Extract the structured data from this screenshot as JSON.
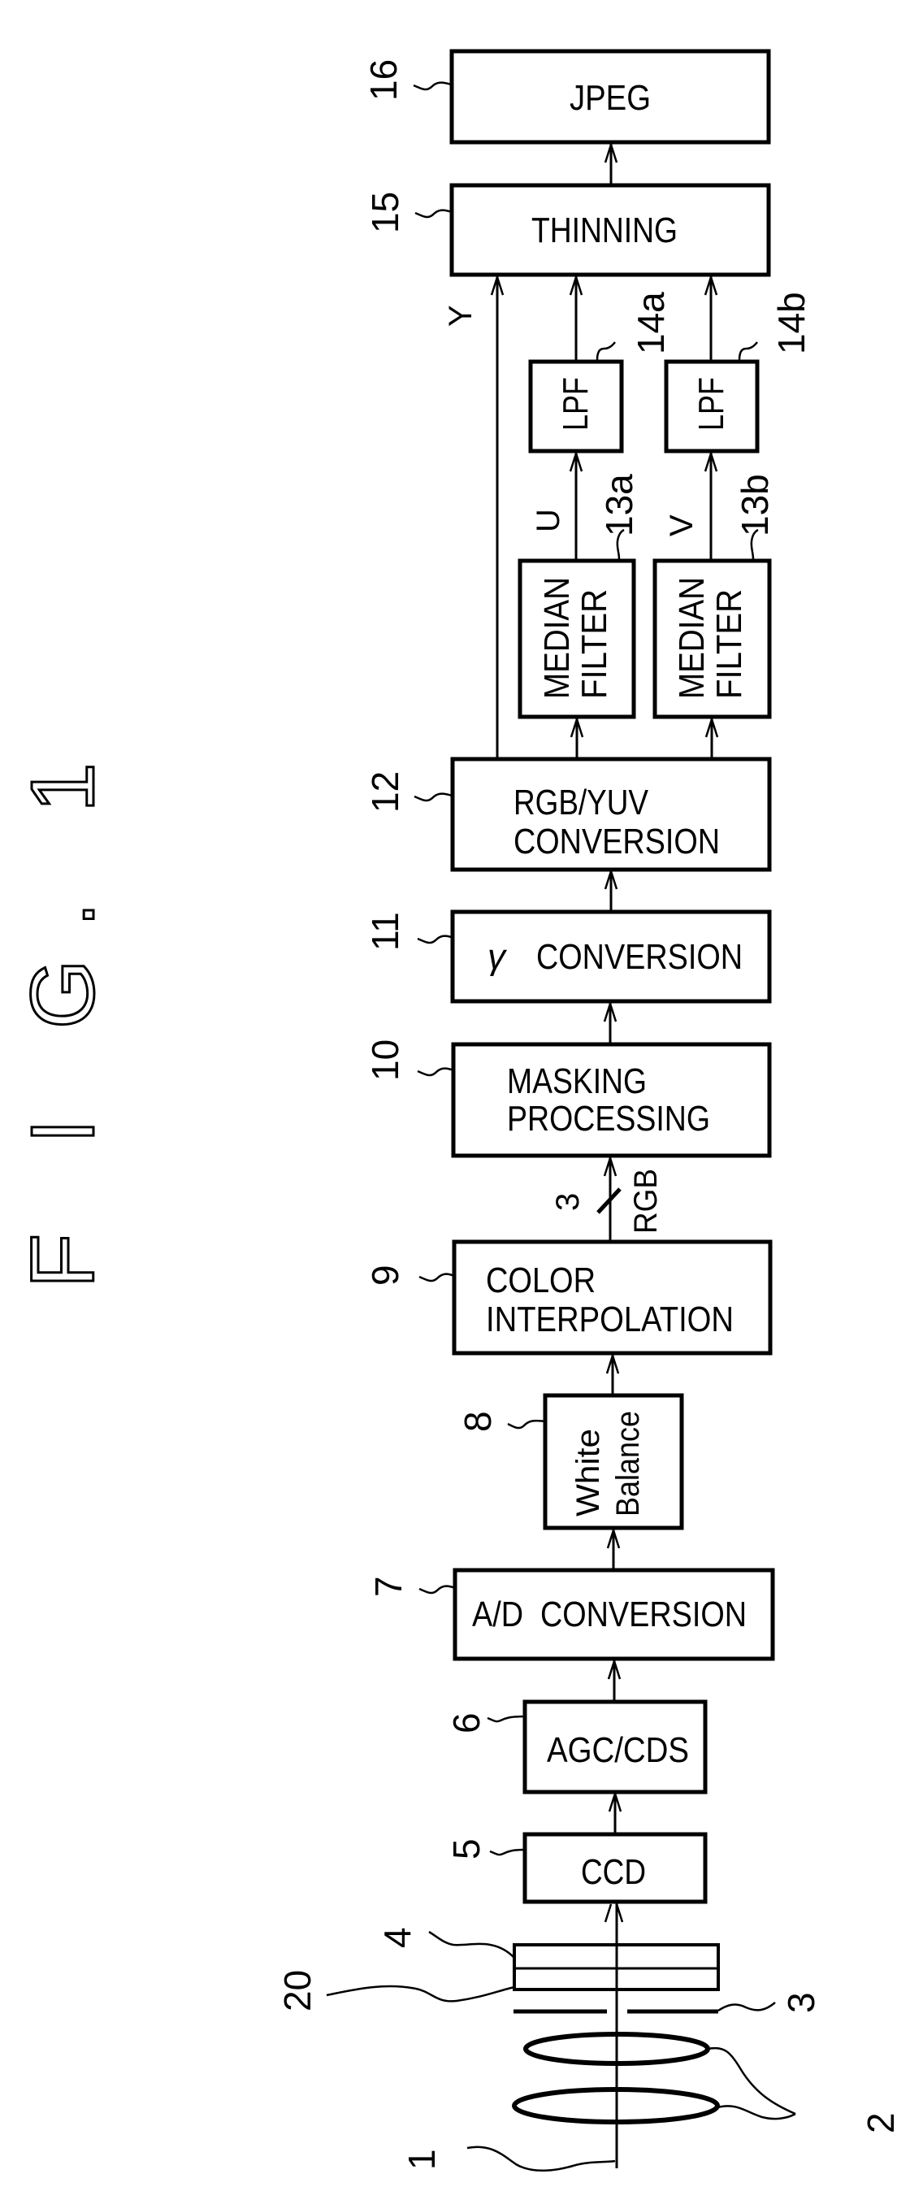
{
  "figure": {
    "title": "F I G. 1"
  },
  "blocks": {
    "jpeg": {
      "ref": "16",
      "label": "JPEG"
    },
    "thinning": {
      "ref": "15",
      "label": "THINNING"
    },
    "lpf_a": {
      "ref": "14a",
      "label": "LPF"
    },
    "lpf_b": {
      "ref": "14b",
      "label": "LPF"
    },
    "median_a": {
      "ref": "13a",
      "line1": "MEDIAN",
      "line2": "FILTER"
    },
    "median_b": {
      "ref": "13b",
      "line1": "MEDIAN",
      "line2": "FILTER"
    },
    "rgb_yuv": {
      "ref": "12",
      "line1": "RGB/YUV",
      "line2": "CONVERSION"
    },
    "gamma": {
      "ref": "11",
      "symbol": "γ",
      "label": "CONVERSION"
    },
    "masking": {
      "ref": "10",
      "line1": "MASKING",
      "line2": "PROCESSING"
    },
    "color_interp": {
      "ref": "9",
      "line1": "COLOR",
      "line2": "INTERPOLATION"
    },
    "white_balance": {
      "ref": "8",
      "line1": "White",
      "line2": "Balance"
    },
    "ad": {
      "ref": "7",
      "label": "A/D  CONVERSION"
    },
    "agc_cds": {
      "ref": "6",
      "label": "AGC/CDS"
    },
    "ccd": {
      "ref": "5",
      "label": "CCD"
    }
  },
  "optics": {
    "filter_ref": "4",
    "filter2_ref": "20",
    "aperture_ref": "3",
    "lens_ref": "2",
    "axis_ref": "1"
  },
  "signals": {
    "y": "Y",
    "u": "U",
    "v": "V",
    "bus_width": "3",
    "bus_name": "RGB"
  }
}
